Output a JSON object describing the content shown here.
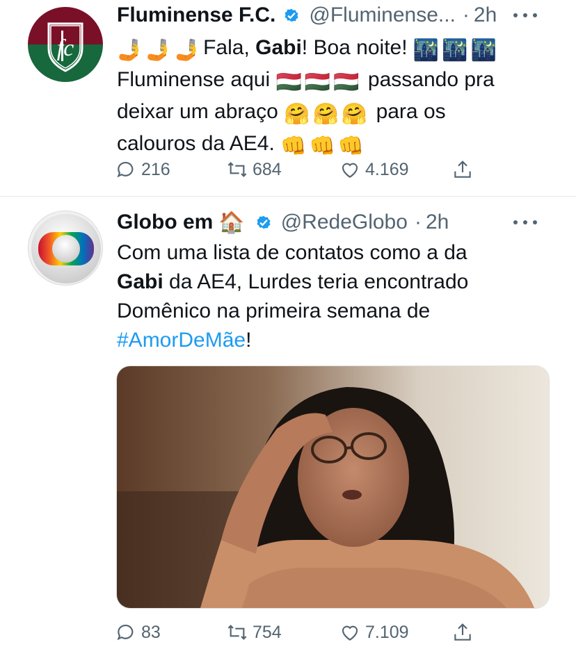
{
  "tweets": [
    {
      "name": "Fluminense F.C.",
      "handle": "@Fluminense...",
      "separator": "·",
      "time": "2h",
      "avatar_icon": "fluminense-crest",
      "body": {
        "line1_text_a": "Fala, ",
        "line1_bold": "Gabi",
        "line1_text_b": "! Boa noite!",
        "line2_text_a": "Fluminense aqui",
        "line2_text_b": "passando pra",
        "line3_text_a": "deixar um abraço",
        "line3_text_b": "para os",
        "line4_text": "calouros da AE4."
      },
      "emojis": {
        "phone": "🤳",
        "night": "🌃",
        "flag": "🇭🇺",
        "hug": "🤗",
        "fist": "👊"
      },
      "stats": {
        "replies": "216",
        "retweets": "684",
        "likes": "4.169"
      }
    },
    {
      "name": "Globo em",
      "name_emoji": "🏠",
      "handle": "@RedeGlobo",
      "separator": "·",
      "time": "2h",
      "avatar_icon": "globo-logo",
      "body": {
        "line1_text": "Com uma lista de contatos como a da",
        "line2_bold": "Gabi",
        "line2_text": " da AE4, Lurdes teria encontrado",
        "line3_text": "Domênico na primeira semana de",
        "hashtag": "#AmorDeMãe",
        "after_hashtag": "!"
      },
      "media": "woman-with-glasses-shielding-eyes",
      "stats": {
        "replies": "83",
        "retweets": "754",
        "likes": "7.109"
      }
    }
  ],
  "colors": {
    "text": "#0f1419",
    "secondary": "#536471",
    "link": "#1d9bf0",
    "verified": "#1d9bf0",
    "divider": "#e6e9eb"
  }
}
